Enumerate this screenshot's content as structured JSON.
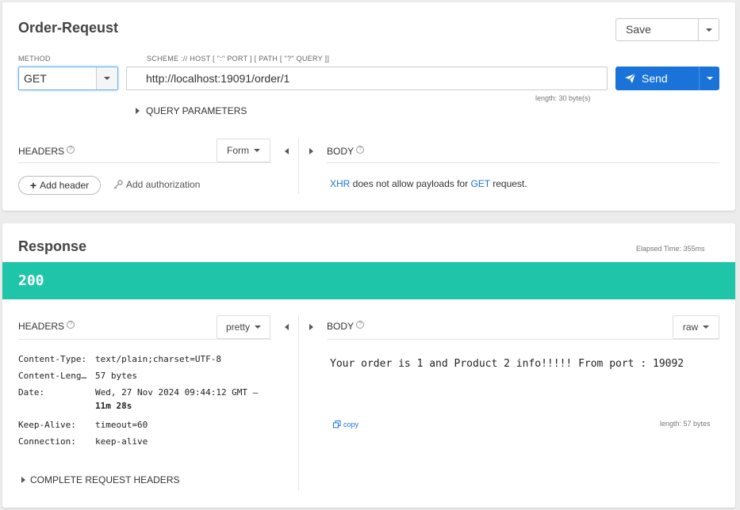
{
  "request": {
    "title": "Order-Reqeust",
    "save_label": "Save",
    "method_label": "METHOD",
    "method_value": "GET",
    "scheme_label": "SCHEME :// HOST [ \":\" PORT ] [ PATH [ \"?\" QUERY ]]",
    "url_value": "http://localhost:19091/order/1",
    "send_label": "Send",
    "url_length": "length: 30 byte(s)",
    "query_params_label": "QUERY PARAMETERS",
    "headers_label": "HEADERS",
    "headers_mode": "Form",
    "body_label": "BODY",
    "add_header_label": "Add header",
    "add_auth_label": "Add authorization",
    "body_notice": {
      "xhr": "XHR",
      "middle": " does not allow payloads for ",
      "method": "GET",
      "end": " request."
    }
  },
  "response": {
    "title": "Response",
    "elapsed": "Elapsed Time: 355ms",
    "status_code": "200",
    "headers_label": "HEADERS",
    "headers_mode": "pretty",
    "body_label": "BODY",
    "body_mode": "raw",
    "headers": [
      {
        "key": "Content-Type:",
        "value": "text/plain;charset=UTF-8"
      },
      {
        "key": "Content-Leng…",
        "value": "57 bytes"
      },
      {
        "key": "Date:",
        "value": "Wed, 27 Nov 2024 09:44:12 GMT –",
        "value2": "11m 28s"
      },
      {
        "key": "Keep-Alive:",
        "value": "timeout=60"
      },
      {
        "key": "Connection:",
        "value": "keep-alive"
      }
    ],
    "body_text": "Your order is 1 and Product 2 info!!!!! From port : 19092",
    "copy_label": "copy",
    "body_length": "length: 57 bytes",
    "complete_headers_label": "COMPLETE REQUEST HEADERS"
  },
  "colors": {
    "accent": "#1a73d9",
    "status_ok": "#1fc5a8"
  }
}
